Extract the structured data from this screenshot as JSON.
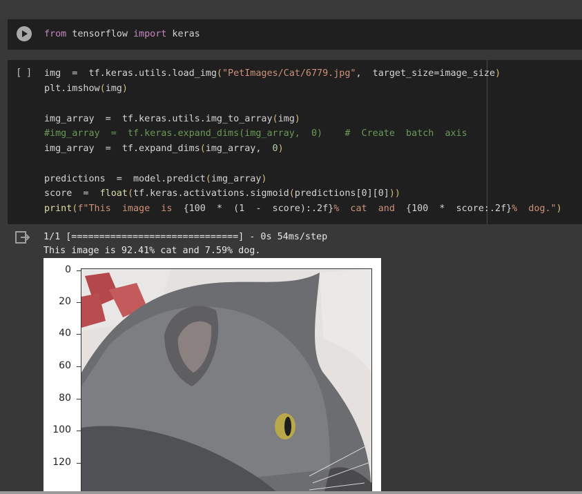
{
  "cells": [
    {
      "lines": [
        [
          [
            "kw",
            "from"
          ],
          [
            "txt",
            " tensorflow "
          ],
          [
            "kw",
            "import"
          ],
          [
            "txt",
            " keras"
          ]
        ]
      ]
    },
    {
      "bracket": "[ ]",
      "lines": [
        [
          [
            "txt",
            "img  =  tf.keras.utils.load_img"
          ],
          [
            "paren",
            "("
          ],
          [
            "str",
            "\"PetImages/Cat/6779.jpg\""
          ],
          [
            "txt",
            ",  target_size=image_size"
          ],
          [
            "paren",
            ")"
          ]
        ],
        [
          [
            "txt",
            "plt.imshow"
          ],
          [
            "paren",
            "("
          ],
          [
            "txt",
            "img"
          ],
          [
            "paren",
            ")"
          ]
        ],
        [],
        [
          [
            "txt",
            "img_array  =  tf.keras.utils.img_to_array"
          ],
          [
            "paren",
            "("
          ],
          [
            "txt",
            "img"
          ],
          [
            "paren",
            ")"
          ]
        ],
        [
          [
            "cm",
            "#img_array  =  tf.keras.expand_dims(img_array,  0)    #  Create  batch  axis"
          ]
        ],
        [
          [
            "txt",
            "img_array  =  tf.expand_dims"
          ],
          [
            "paren",
            "("
          ],
          [
            "txt",
            "img_array,  "
          ],
          [
            "num",
            "0"
          ],
          [
            "paren",
            ")"
          ]
        ],
        [],
        [
          [
            "txt",
            "predictions  =  model.predict"
          ],
          [
            "paren",
            "("
          ],
          [
            "txt",
            "img_array"
          ],
          [
            "paren",
            ")"
          ]
        ],
        [
          [
            "txt",
            "score  =  "
          ],
          [
            "fn",
            "float"
          ],
          [
            "paren",
            "("
          ],
          [
            "txt",
            "tf.keras.activations.sigmoid"
          ],
          [
            "paren",
            "("
          ],
          [
            "txt",
            "predictions[0][0]"
          ],
          [
            "paren",
            "))"
          ]
        ],
        [
          [
            "fn",
            "print"
          ],
          [
            "paren",
            "("
          ],
          [
            "str",
            "f\"This  image  is  "
          ],
          [
            "txt",
            "{100  *  (1  -  score):.2f}"
          ],
          [
            "str",
            "%  cat  and  "
          ],
          [
            "txt",
            "{100  *  score:.2f}"
          ],
          [
            "str",
            "%  dog.\""
          ],
          [
            "paren",
            ")"
          ]
        ]
      ]
    }
  ],
  "output": {
    "progress_line": "1/1 [==============================] - 0s 54ms/step",
    "result_line": "This image is 92.41% cat and 7.59% dog.",
    "y_ticks": [
      "0",
      "20",
      "40",
      "60",
      "80",
      "100",
      "120"
    ]
  },
  "colors": {
    "background": "#383838",
    "cell_bg": "#1f1f1f",
    "keyword": "#c586c0",
    "comment": "#6a9955",
    "string": "#ce9178"
  }
}
